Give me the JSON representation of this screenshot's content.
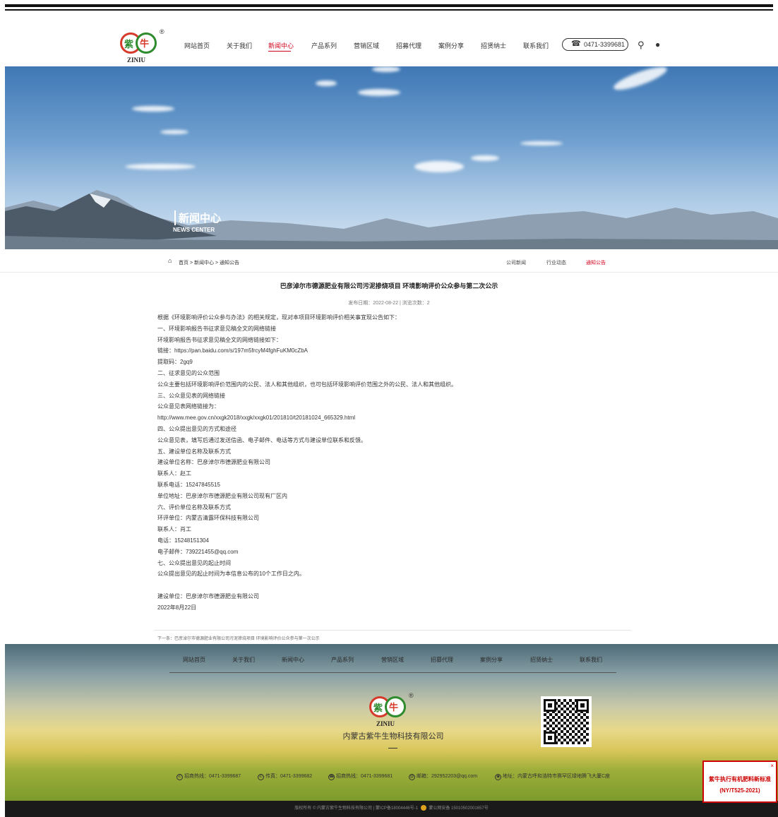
{
  "header": {
    "logo_char_1": "紫",
    "logo_char_2": "牛",
    "logo_reg": "®",
    "logo_text": "ZINIU",
    "nav": [
      "网站首页",
      "关于我们",
      "新闻中心",
      "产品系列",
      "营销区域",
      "招募代理",
      "案例分享",
      "招贤纳士",
      "联系我们"
    ],
    "active_nav": "新闻中心",
    "phone": "0471-3399681",
    "accent_color": "#d0021b"
  },
  "banner": {
    "title": "新闻中心",
    "subtitle": "NEWS CENTER"
  },
  "breadcrumb": {
    "text": "首页 > 新闻中心 > 通知公告"
  },
  "subnav": [
    "公司新闻",
    "行业动态",
    "通知公告"
  ],
  "article": {
    "title": "巴彦淖尔市德源肥业有限公司污泥掺烧项目 环境影响评价公众参与第二次公示",
    "meta": "发布日期：2022-08-22 | 浏览次数：2",
    "lines": [
      "根据《环境影响评价公众参与办法》的相关规定，现对本项目环境影响评价相关事宜现公告如下：",
      "一、环境影响报告书征求意见稿全文的网络链接",
      "环境影响报告书征求意见稿全文的网络链接如下：",
      "链接：https://pan.baidu.com/s/197m5frcyM4fghFuKM0cZbA",
      "提取码：2gq9",
      "二、征求意见的公众范围",
      "公众主要包括环境影响评价范围内的公民、法人和其他组织，也可包括环境影响评价范围之外的公民、法人和其他组织。",
      "三、公众意见表的网络链接",
      "公众意见表网络链接为：",
      "http://www.mee.gov.cn/xxgk2018/xxgk/xxgk01/201810/t20181024_665329.html",
      "四、公众提出意见的方式和途径",
      "公众意见表，填写后通过发送信函、电子邮件、电话等方式与建设单位联系和反馈。",
      "五、建设单位名称及联系方式",
      "建设单位名称：巴彦淖尔市德源肥业有限公司",
      "联系人：赵工",
      "联系电话：15247845515",
      "单位地址：巴彦淖尔市德源肥业有限公司现有厂区内",
      "六、评价单位名称及联系方式",
      "环评单位：内蒙古清露环保科技有限公司",
      "联系人：肖工",
      "电话：15248151304",
      "电子邮件：739221455@qq.com",
      "七、公众提出意见的起止时间",
      "公众提出意见的起止时间为本信息公布的10个工作日之内。",
      "",
      "建设单位：巴彦淖尔市德源肥业有限公司",
      "2022年8月22日"
    ],
    "next": "下一条：巴彦淖尔市德源肥业有限公司污泥掺烧项目 环境影响评价公众参与第一次公示"
  },
  "footer": {
    "nav": [
      "网站首页",
      "关于我们",
      "新闻中心",
      "产品系列",
      "营销区域",
      "招募代理",
      "案例分享",
      "招贤纳士",
      "联系我们"
    ],
    "company": "内蒙古紫牛生物科技有限公司",
    "info": [
      "招商热线：0471-3399687",
      "传真：0471-3399682",
      "招商热线：0471-3399681",
      "邮箱：292952203@qq.com",
      "地址：内蒙古呼和浩特市赛罕区绿地腾飞大厦C座"
    ],
    "copyright_left": "版权所有 © 内蒙古紫牛生物科技有限公司 | 蒙ICP备18004446号-1",
    "copyright_right": "蒙公网安备 15010502001657号"
  },
  "float_ad": {
    "line1": "紫牛执行有机肥料新标准",
    "line2": "(NY/T525-2021)",
    "close": "×"
  }
}
